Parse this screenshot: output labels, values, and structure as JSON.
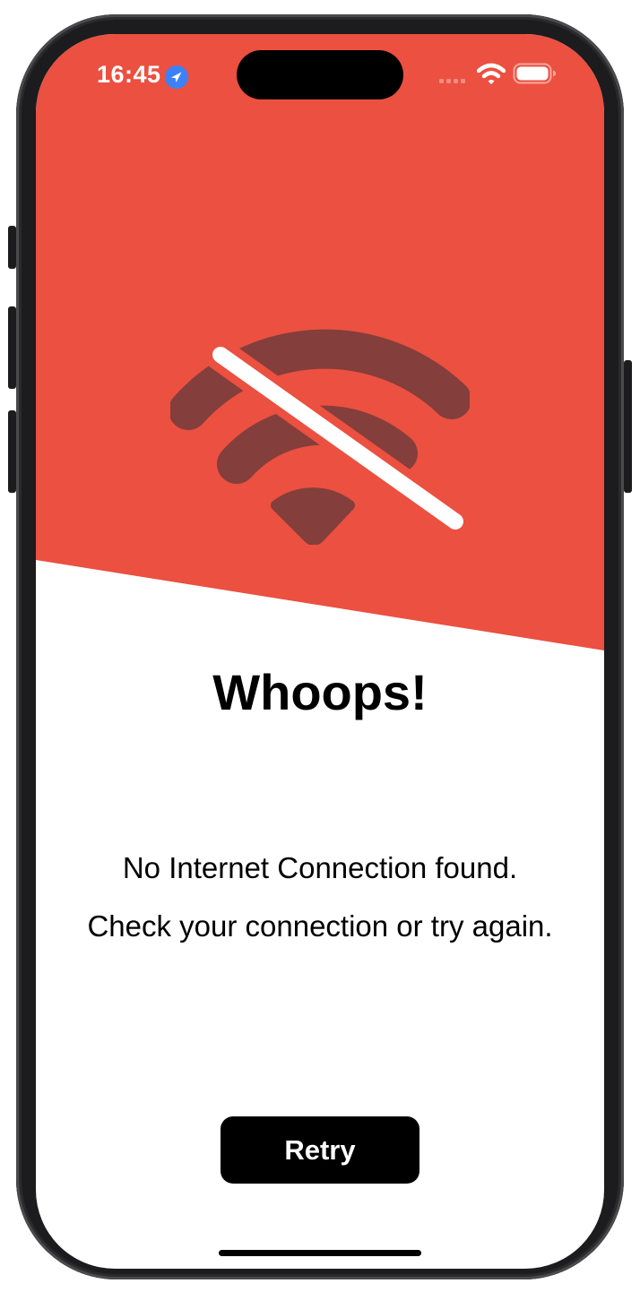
{
  "status_bar": {
    "time": "16:45",
    "icons": [
      "location-icon",
      "signal-icon",
      "wifi-icon",
      "battery-icon"
    ]
  },
  "hero": {
    "icon": "wifi-slash-icon",
    "background_color": "#EB5040",
    "icon_color": "#843E3B"
  },
  "title": "Whoops!",
  "message": {
    "line1": "No Internet Connection found.",
    "line2": "Check your connection or try again."
  },
  "retry_button": {
    "label": "Retry"
  },
  "colors": {
    "accent": "#EB5040",
    "button_bg": "#000000",
    "button_text": "#FFFFFF"
  }
}
